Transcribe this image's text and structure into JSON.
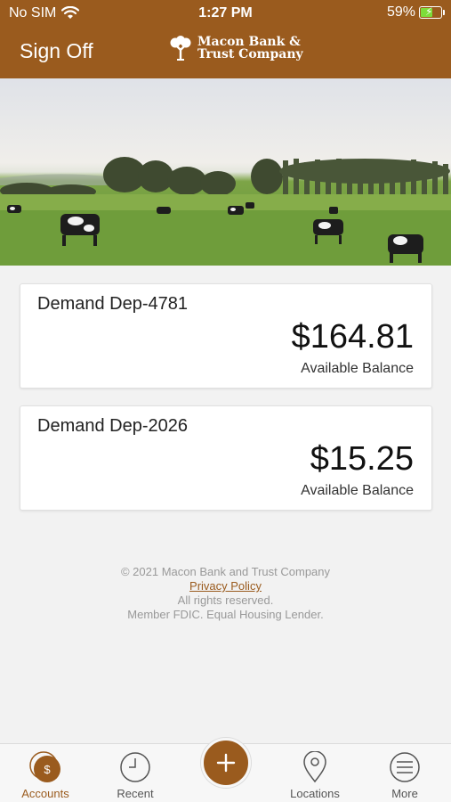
{
  "status_bar": {
    "carrier": "No SIM",
    "time": "1:27 PM",
    "battery": "59%",
    "battery_level": 0.59
  },
  "header": {
    "sign_off": "Sign Off",
    "logo_line1": "Macon Bank &",
    "logo_line2": "Trust Company",
    "background_color": "#9a5b1e"
  },
  "accounts": [
    {
      "name": "Demand Dep-4781",
      "amount": "$164.81",
      "label": "Available Balance"
    },
    {
      "name": "Demand Dep-2026",
      "amount": "$15.25",
      "label": "Available Balance"
    }
  ],
  "legal": {
    "copyright": "© 2021 Macon Bank and Trust Company",
    "privacy": "Privacy Policy",
    "rights": "All rights reserved.",
    "fdic": "Member FDIC. Equal Housing Lender."
  },
  "tabbar": {
    "accounts": "Accounts",
    "recent": "Recent",
    "locations": "Locations",
    "more": "More",
    "accent_color": "#9a5b1e"
  }
}
